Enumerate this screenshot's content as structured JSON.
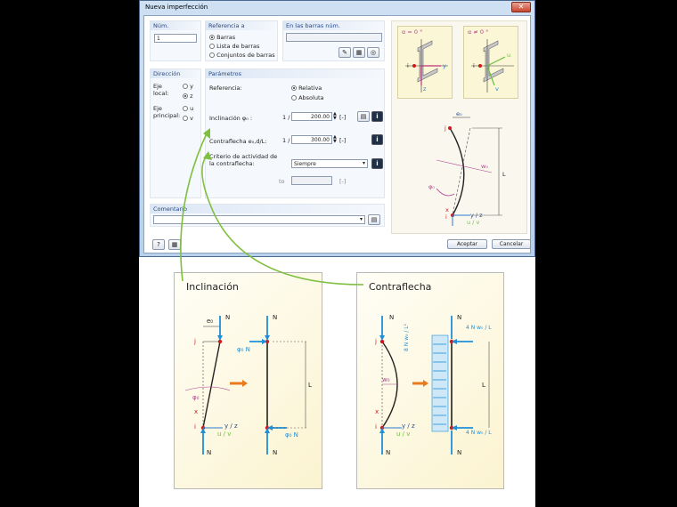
{
  "dialog": {
    "title": "Nueva imperfección",
    "close": "✕",
    "num": {
      "label": "Núm.",
      "value": "1"
    },
    "referencia": {
      "header": "Referencia a",
      "options": [
        "Barras",
        "Lista de barras",
        "Conjuntos de barras"
      ],
      "selected": 0
    },
    "en_barras": {
      "header": "En las barras núm."
    },
    "direccion": {
      "header": "Dirección",
      "eje_local": "Eje local:",
      "eje_principal": "Eje principal:",
      "opts": [
        "y",
        "z",
        "u",
        "v"
      ],
      "selected": 1
    },
    "parametros": {
      "header": "Parámetros",
      "referencia": "Referencia:",
      "ref_options": [
        "Relativa",
        "Absoluta"
      ],
      "inclinacion_label": "Inclinación φ₀ :",
      "inclinacion_prefix": "1 /",
      "inclinacion_value": "200.00",
      "inclinacion_unit": "[-]",
      "contraflecha_label": "Contraflecha e₀,d/L:",
      "contraflecha_prefix": "1 /",
      "contraflecha_value": "300.00",
      "contraflecha_unit": "[-]",
      "criterio_label": "Criterio de actividad de la contraflecha:",
      "criterio_value": "Siempre",
      "to_label": "to",
      "to_unit": "[-]"
    },
    "comentario": {
      "header": "Comentario"
    },
    "buttons": {
      "aceptar": "Aceptar",
      "cancelar": "Cancelar"
    },
    "sketch_labels": {
      "alpha0": "α = 0 °",
      "alphane0": "α ≠ 0 °",
      "e0": "e₀",
      "w0": "w₀",
      "phi0": "φ₀",
      "L": "L",
      "j": "j",
      "i": "i",
      "x": "x",
      "yz": "y / z",
      "uv": "u / v",
      "z": "z",
      "y": "y",
      "u": "u",
      "v": "v"
    }
  },
  "panels": {
    "inclinacion": {
      "title": "Inclinación",
      "N": "N",
      "e0": "e₀",
      "j": "j",
      "i": "i",
      "phi0": "φ₀",
      "x": "x",
      "phiN": "φ₀ N",
      "L": "L",
      "yz": "y / z",
      "uv": "u / v"
    },
    "contraflecha": {
      "title": "Contraflecha",
      "N": "N",
      "w0": "w₀",
      "j": "j",
      "i": "i",
      "x": "x",
      "L": "L",
      "yz": "y / z",
      "uv": "u / v",
      "load_formula": "8 N w₀ / L²",
      "top_force": "4 N w₀ / L",
      "bottom_force": "4 N w₀ / L"
    }
  },
  "colors": {
    "accent": "#2a4a86",
    "arrow": "#1e8fd8",
    "member": "#cc1a1a",
    "pink": "#b04090",
    "green": "#7fbf3f",
    "orange": "#e87b1e"
  }
}
